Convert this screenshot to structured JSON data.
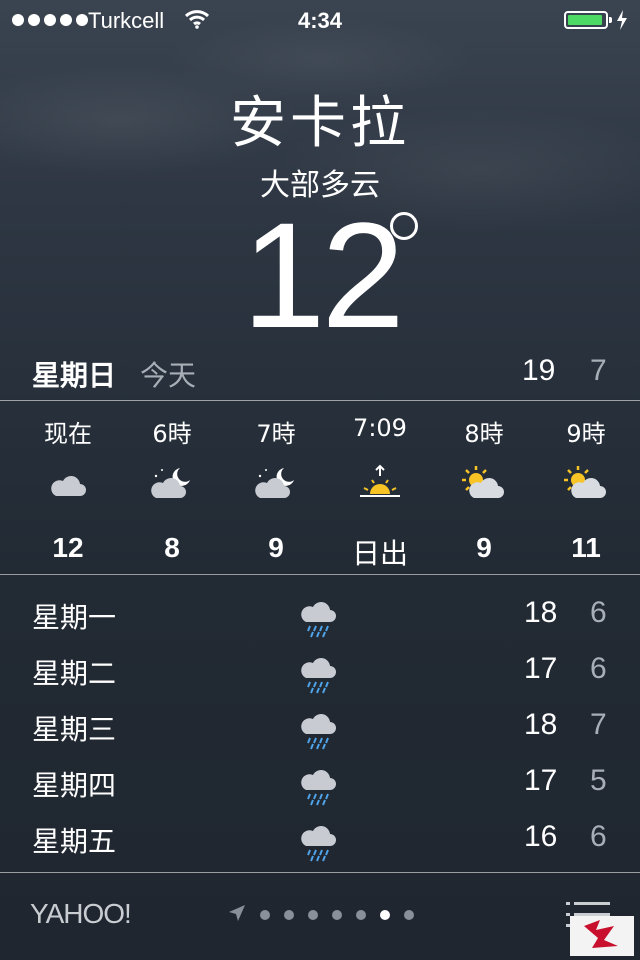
{
  "status_bar": {
    "carrier": "Turkcell",
    "time": "4:34",
    "battery_color": "#4cd964",
    "battery_level": 0.95
  },
  "location": {
    "city": "安卡拉",
    "condition": "大部多云",
    "temperature": "12"
  },
  "today": {
    "day": "星期日",
    "label": "今天",
    "high": "19",
    "low": "7"
  },
  "hourly": [
    {
      "label": "现在",
      "icon": "cloud-icon",
      "value": "12"
    },
    {
      "label": "6時",
      "icon": "night-cloud-icon",
      "value": "8"
    },
    {
      "label": "7時",
      "icon": "night-cloud-icon",
      "value": "9"
    },
    {
      "label": "7:09",
      "icon": "sunrise-icon",
      "value": "日出"
    },
    {
      "label": "8時",
      "icon": "sun-cloud-icon",
      "value": "9"
    },
    {
      "label": "9時",
      "icon": "sun-cloud-icon",
      "value": "11"
    }
  ],
  "daily": [
    {
      "day": "星期一",
      "icon": "rain-cloud-icon",
      "high": "18",
      "low": "6"
    },
    {
      "day": "星期二",
      "icon": "rain-cloud-icon",
      "high": "17",
      "low": "6"
    },
    {
      "day": "星期三",
      "icon": "rain-cloud-icon",
      "high": "18",
      "low": "7"
    },
    {
      "day": "星期四",
      "icon": "rain-cloud-icon",
      "high": "17",
      "low": "5"
    },
    {
      "day": "星期五",
      "icon": "rain-cloud-icon",
      "high": "16",
      "low": "6"
    }
  ],
  "footer": {
    "provider": "YAHOO!",
    "page_count": 7,
    "active_page": 6
  }
}
